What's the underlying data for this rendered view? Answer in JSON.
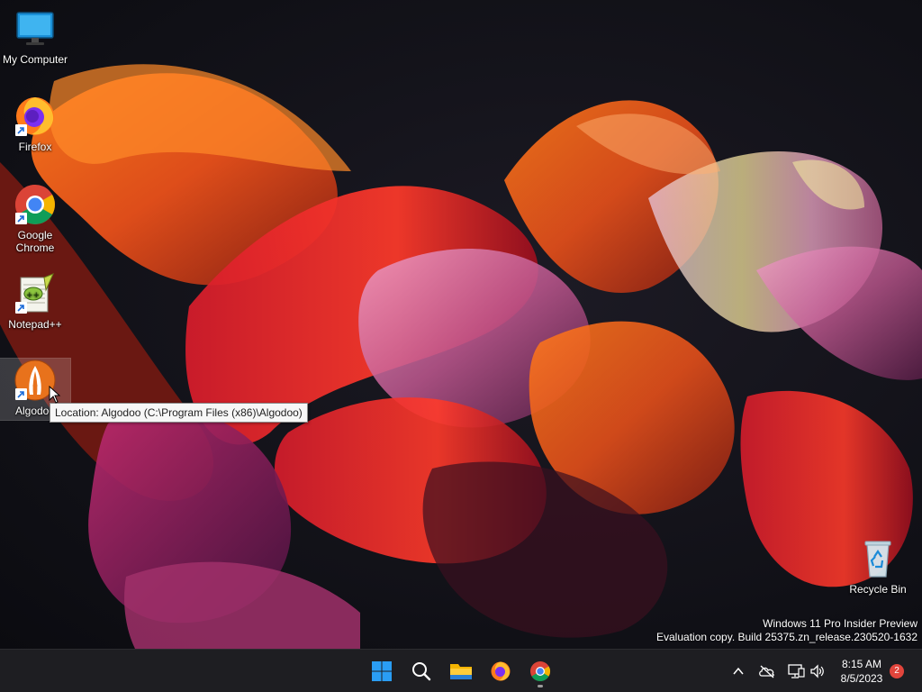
{
  "desktop": {
    "icons": [
      {
        "label": "My Computer",
        "icon": "monitor-icon"
      },
      {
        "label": "Firefox",
        "icon": "firefox-icon"
      },
      {
        "label": "Google Chrome",
        "icon": "chrome-icon"
      },
      {
        "label": "Notepad++",
        "icon": "notepadpp-icon"
      },
      {
        "label": "Algodoo",
        "icon": "algodoo-icon"
      },
      {
        "label": "Recycle Bin",
        "icon": "recycle-bin-icon"
      }
    ],
    "tooltip": "Location: Algodoo (C:\\Program Files (x86)\\Algodoo)",
    "watermark": {
      "line1": "Windows 11 Pro Insider Preview",
      "line2": "Evaluation copy. Build 25375.zn_release.230520-1632"
    }
  },
  "taskbar": {
    "apps": [
      {
        "name": "Start",
        "icon": "windows-start-icon"
      },
      {
        "name": "Search",
        "icon": "search-icon"
      },
      {
        "name": "File Explorer",
        "icon": "folder-icon"
      },
      {
        "name": "Firefox",
        "icon": "firefox-icon"
      },
      {
        "name": "Google Chrome",
        "icon": "chrome-icon",
        "running": true
      }
    ],
    "tray": {
      "icons": [
        "chevron-up-icon",
        "onedrive-offline-icon",
        "network-icon",
        "speaker-icon"
      ],
      "time": "8:15 AM",
      "date": "8/5/2023",
      "notification_count": "2"
    }
  },
  "colors": {
    "taskbar_bg": "#1e1e22",
    "start_blue": "#0078d4",
    "badge_red": "#e2453c",
    "tooltip_bg": "#f7f7f7"
  }
}
